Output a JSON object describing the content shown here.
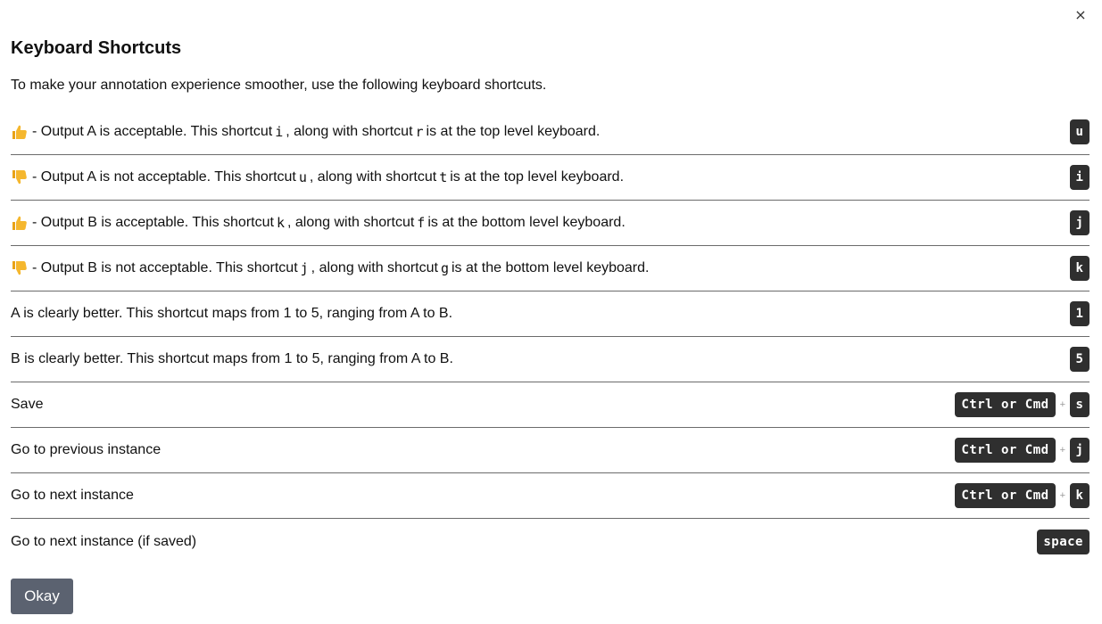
{
  "dialog": {
    "close_label": "×",
    "title": "Keyboard Shortcuts",
    "intro": "To make your annotation experience smoother, use the following keyboard shortcuts.",
    "okay_label": "Okay"
  },
  "shortcuts": [
    {
      "icon": "thumbs-up-icon",
      "prefix": " - Output A is acceptable. This shortcut ",
      "code1": "i",
      "middle": ", along with shortcut ",
      "code2": "r",
      "suffix": " is at the top level keyboard.",
      "keys": [
        "u"
      ]
    },
    {
      "icon": "thumbs-down-icon",
      "prefix": " - Output A is not acceptable. This shortcut ",
      "code1": "u",
      "middle": ", along with shortcut ",
      "code2": "t",
      "suffix": " is at the top level keyboard.",
      "keys": [
        "i"
      ]
    },
    {
      "icon": "thumbs-up-icon",
      "prefix": " - Output B is acceptable. This shortcut ",
      "code1": "k",
      "middle": ", along with shortcut ",
      "code2": "f",
      "suffix": " is at the bottom level keyboard.",
      "keys": [
        "j"
      ]
    },
    {
      "icon": "thumbs-down-icon",
      "prefix": " - Output B is not acceptable. This shortcut ",
      "code1": "j",
      "middle": ", along with shortcut ",
      "code2": "g",
      "suffix": " is at the bottom level keyboard.",
      "keys": [
        "k"
      ]
    },
    {
      "text": "A is clearly better. This shortcut maps from 1 to 5, ranging from A to B.",
      "keys": [
        "1"
      ]
    },
    {
      "text": "B is clearly better. This shortcut maps from 1 to 5, ranging from A to B.",
      "keys": [
        "5"
      ]
    },
    {
      "text": "Save",
      "keys": [
        "Ctrl or Cmd",
        "s"
      ]
    },
    {
      "text": "Go to previous instance",
      "keys": [
        "Ctrl or Cmd",
        "j"
      ]
    },
    {
      "text": "Go to next instance",
      "keys": [
        "Ctrl or Cmd",
        "k"
      ]
    },
    {
      "text": "Go to next instance (if saved)",
      "keys": [
        "space"
      ]
    }
  ],
  "plus_sign": "+",
  "colors": {
    "key_bg": "#2f2f2f",
    "button_bg": "#5b6270",
    "thumb": "#f5b72e"
  }
}
